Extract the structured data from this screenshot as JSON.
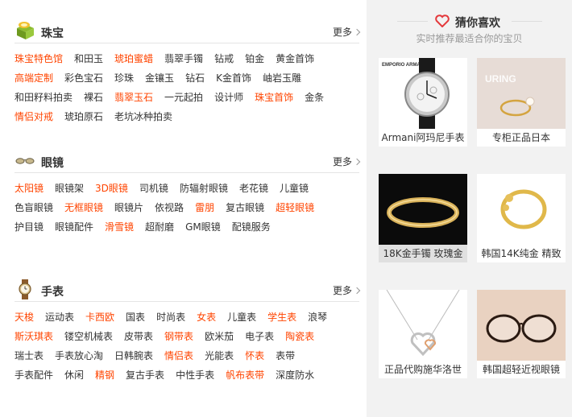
{
  "sections": [
    {
      "id": "jewelry",
      "title": "珠宝",
      "more": "更多",
      "icon": "jewelry-box-icon",
      "rows": [
        [
          {
            "t": "珠宝特色馆",
            "hot": true
          },
          {
            "t": "和田玉"
          },
          {
            "t": "琥珀蜜蜡",
            "hot": true
          },
          {
            "t": "翡翠手镯"
          },
          {
            "t": "钻戒"
          },
          {
            "t": "铂金"
          },
          {
            "t": "黄金首饰"
          }
        ],
        [
          {
            "t": "高端定制",
            "hot": true
          },
          {
            "t": "彩色宝石"
          },
          {
            "t": "珍珠"
          },
          {
            "t": "金镶玉"
          },
          {
            "t": "钻石"
          },
          {
            "t": "K金首饰"
          },
          {
            "t": "岫岩玉雕"
          }
        ],
        [
          {
            "t": "和田籽料拍卖"
          },
          {
            "t": "裸石"
          },
          {
            "t": "翡翠玉石",
            "hot": true
          },
          {
            "t": "一元起拍"
          },
          {
            "t": "设计师"
          },
          {
            "t": "珠宝首饰",
            "hot": true
          },
          {
            "t": "金条"
          }
        ],
        [
          {
            "t": "情侣对戒",
            "hot": true
          },
          {
            "t": "琥珀原石"
          },
          {
            "t": "老坑冰种拍卖"
          }
        ]
      ]
    },
    {
      "id": "glasses",
      "title": "眼镜",
      "more": "更多",
      "icon": "glasses-icon",
      "rows": [
        [
          {
            "t": "太阳镜",
            "hot": true
          },
          {
            "t": "眼镜架"
          },
          {
            "t": "3D眼镜",
            "hot": true
          },
          {
            "t": "司机镜"
          },
          {
            "t": "防辐射眼镜"
          },
          {
            "t": "老花镜"
          },
          {
            "t": "儿童镜"
          }
        ],
        [
          {
            "t": "色盲眼镜"
          },
          {
            "t": "无框眼镜",
            "hot": true
          },
          {
            "t": "眼镜片"
          },
          {
            "t": "依视路"
          },
          {
            "t": "雷朋",
            "hot": true
          },
          {
            "t": "复古眼镜"
          },
          {
            "t": "超轻眼镜",
            "hot": true
          }
        ],
        [
          {
            "t": "护目镜"
          },
          {
            "t": "眼镜配件"
          },
          {
            "t": "滑雪镜",
            "hot": true
          },
          {
            "t": "超耐磨"
          },
          {
            "t": "GM眼镜"
          },
          {
            "t": "配镜服务"
          }
        ]
      ]
    },
    {
      "id": "watches",
      "title": "手表",
      "more": "更多",
      "icon": "watch-icon",
      "rows": [
        [
          {
            "t": "天梭",
            "hot": true
          },
          {
            "t": "运动表"
          },
          {
            "t": "卡西欧",
            "hot": true
          },
          {
            "t": "国表"
          },
          {
            "t": "时尚表"
          },
          {
            "t": "女表",
            "hot": true
          },
          {
            "t": "儿童表"
          },
          {
            "t": "学生表",
            "hot": true
          },
          {
            "t": "浪琴"
          }
        ],
        [
          {
            "t": "斯沃琪表",
            "hot": true
          },
          {
            "t": "镂空机械表"
          },
          {
            "t": "皮带表"
          },
          {
            "t": "钢带表",
            "hot": true
          },
          {
            "t": "欧米茄"
          },
          {
            "t": "电子表"
          },
          {
            "t": "陶瓷表",
            "hot": true
          }
        ],
        [
          {
            "t": "瑞士表"
          },
          {
            "t": "手表放心淘"
          },
          {
            "t": "日韩腕表"
          },
          {
            "t": "情侣表",
            "hot": true
          },
          {
            "t": "光能表"
          },
          {
            "t": "怀表",
            "hot": true
          },
          {
            "t": "表带"
          }
        ],
        [
          {
            "t": "手表配件"
          },
          {
            "t": "休闲"
          },
          {
            "t": "精钢",
            "hot": true
          },
          {
            "t": "复古手表"
          },
          {
            "t": "中性手表"
          },
          {
            "t": "帆布表带",
            "hot": true
          },
          {
            "t": "深度防水"
          }
        ]
      ]
    }
  ],
  "recommend": {
    "title": "猜你喜欢",
    "subtitle": "实时推荐最适合你的宝贝",
    "products": [
      {
        "caption": "Armani阿玛尼手表",
        "brand": "EMPORIO ARMANI",
        "img": "watch"
      },
      {
        "caption": "专柜正品日本",
        "brand": "URING",
        "img": "pearl-ring"
      },
      {
        "caption": "18K金手镯 玫瑰金",
        "brand": "",
        "img": "bangle"
      },
      {
        "caption": "韩国14K纯金 精致",
        "brand": "",
        "img": "gold-ring"
      },
      {
        "caption": "正品代购施华洛世",
        "brand": "",
        "img": "heart-necklace"
      },
      {
        "caption": "韩国超轻近视眼镜",
        "brand": "",
        "img": "eyeglasses"
      }
    ]
  },
  "colors": {
    "hot": "#ff4400",
    "accent": "#e4393c",
    "panel": "#f2f2f2"
  }
}
